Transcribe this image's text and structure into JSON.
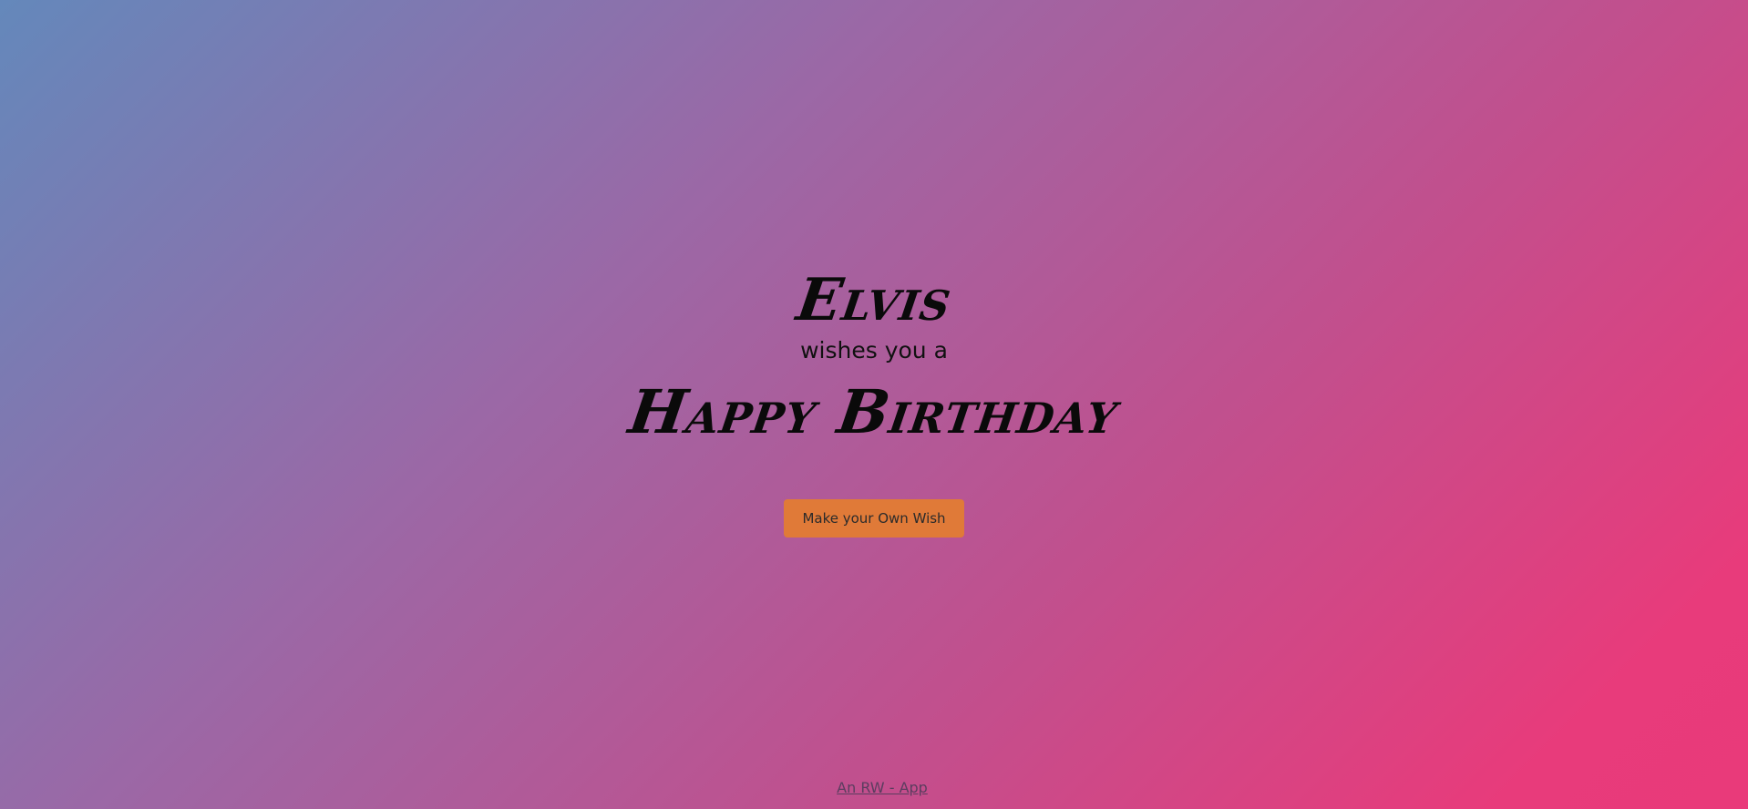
{
  "card": {
    "sender_name": "Elvis",
    "wishes_text": "wishes you a",
    "greeting": "Happy Birthday"
  },
  "cta": {
    "label": "Make your Own Wish",
    "color": "#e07a38"
  },
  "footer": {
    "link_text": "An RW - App"
  },
  "theme": {
    "gradient_start": "#6488bb",
    "gradient_end": "#e93a7a"
  }
}
